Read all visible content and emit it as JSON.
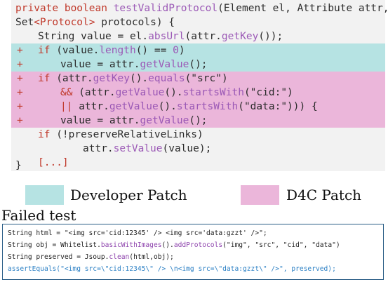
{
  "colors": {
    "developer_patch": "#b6e3e3",
    "d4c_patch": "#ebb6da",
    "keyword": "#c0392b",
    "method": "#9b59b6",
    "box_border": "#2a5d86"
  },
  "code": {
    "line1": {
      "kw": "private boolean ",
      "fn": "testValidProtocol",
      "rest": "(Element el, Attribute attr,"
    },
    "line2": {
      "a": "Set",
      "b": "<Protocol>",
      "c": " protocols) {"
    },
    "line3": {
      "a": "String value = el.",
      "fn1": "absUrl",
      "b": "(attr.",
      "fn2": "getKey",
      "c": "());"
    },
    "line4": {
      "marker": "+",
      "kw": "if",
      "a": " (value.",
      "fn": "length",
      "b": "() == ",
      "num": "0",
      "c": ")"
    },
    "line5": {
      "marker": "+",
      "a": "value = attr.",
      "fn": "getValue",
      "b": "();"
    },
    "line6": {
      "marker": "+",
      "kw": "if",
      "a": " (attr.",
      "fn1": "getKey",
      "b": "().",
      "fn2": "equals",
      "c": "(\"src\")"
    },
    "line7": {
      "marker": "+",
      "kw": "&&",
      "a": " (attr.",
      "fn1": "getValue",
      "b": "().",
      "fn2": "startsWith",
      "c": "(\"cid:\")"
    },
    "line8": {
      "marker": "+",
      "kw": "||",
      "a": " attr.",
      "fn1": "getValue",
      "b": "().",
      "fn2": "startsWith",
      "c": "(\"data:\"))) {"
    },
    "line9": {
      "marker": "+",
      "a": "value = attr.",
      "fn": "getValue",
      "b": "();"
    },
    "line10": {
      "kw": "if",
      "a": " (!preserveRelativeLinks)"
    },
    "line11": {
      "a": "attr.",
      "fn": "setValue",
      "b": "(value);"
    },
    "line12": {
      "a": "[...]"
    },
    "line13": {
      "a": "}"
    }
  },
  "legend": {
    "developer": "Developer Patch",
    "d4c": "D4C Patch"
  },
  "failed_test": {
    "title": "Failed test",
    "line1": "String html = \"<img src='cid:12345' /> <img src='data:gzzt' />\";",
    "line2": {
      "a": "String obj = Whitelist.",
      "fn1": "basicWithImages",
      "b": "().",
      "fn2": "addProtocols",
      "c": "(\"img\", \"src\", \"cid\", \"data\")"
    },
    "line3": {
      "a": "String preserved = Jsoup.",
      "fn": "clean",
      "b": "(html,obj);"
    },
    "line4": "assertEquals(\"<img src=\\\"cid:12345\\\" /> \\n<img src=\\\"data:gzzt\\\" />\", preserved);"
  }
}
